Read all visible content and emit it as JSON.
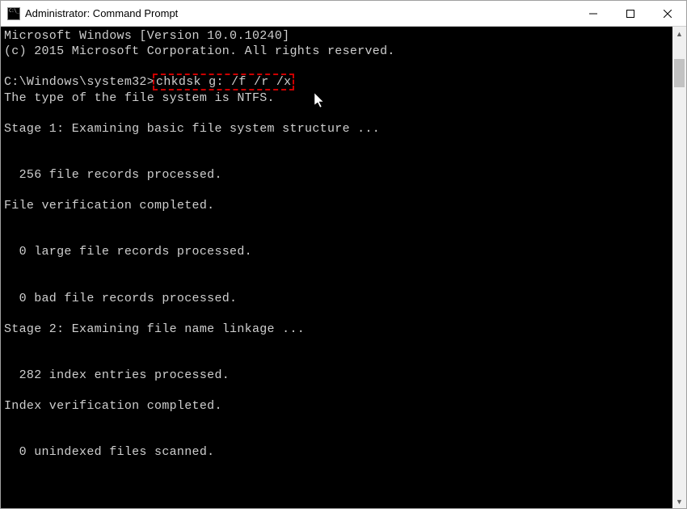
{
  "window": {
    "title": "Administrator: Command Prompt"
  },
  "console": {
    "banner_line1": "Microsoft Windows [Version 10.0.10240]",
    "banner_line2": "(c) 2015 Microsoft Corporation. All rights reserved.",
    "prompt": "C:\\Windows\\system32>",
    "command": "chkdsk g: /f /r /x",
    "output": {
      "fs_type": "The type of the file system is NTFS.",
      "stage1": "Stage 1: Examining basic file system structure ...",
      "file_records": "  256 file records processed.",
      "file_verify": "File verification completed.",
      "large_records": "  0 large file records processed.",
      "bad_records": "  0 bad file records processed.",
      "stage2": "Stage 2: Examining file name linkage ...",
      "index_entries": "  282 index entries processed.",
      "index_verify": "Index verification completed.",
      "unindexed": "  0 unindexed files scanned."
    }
  }
}
